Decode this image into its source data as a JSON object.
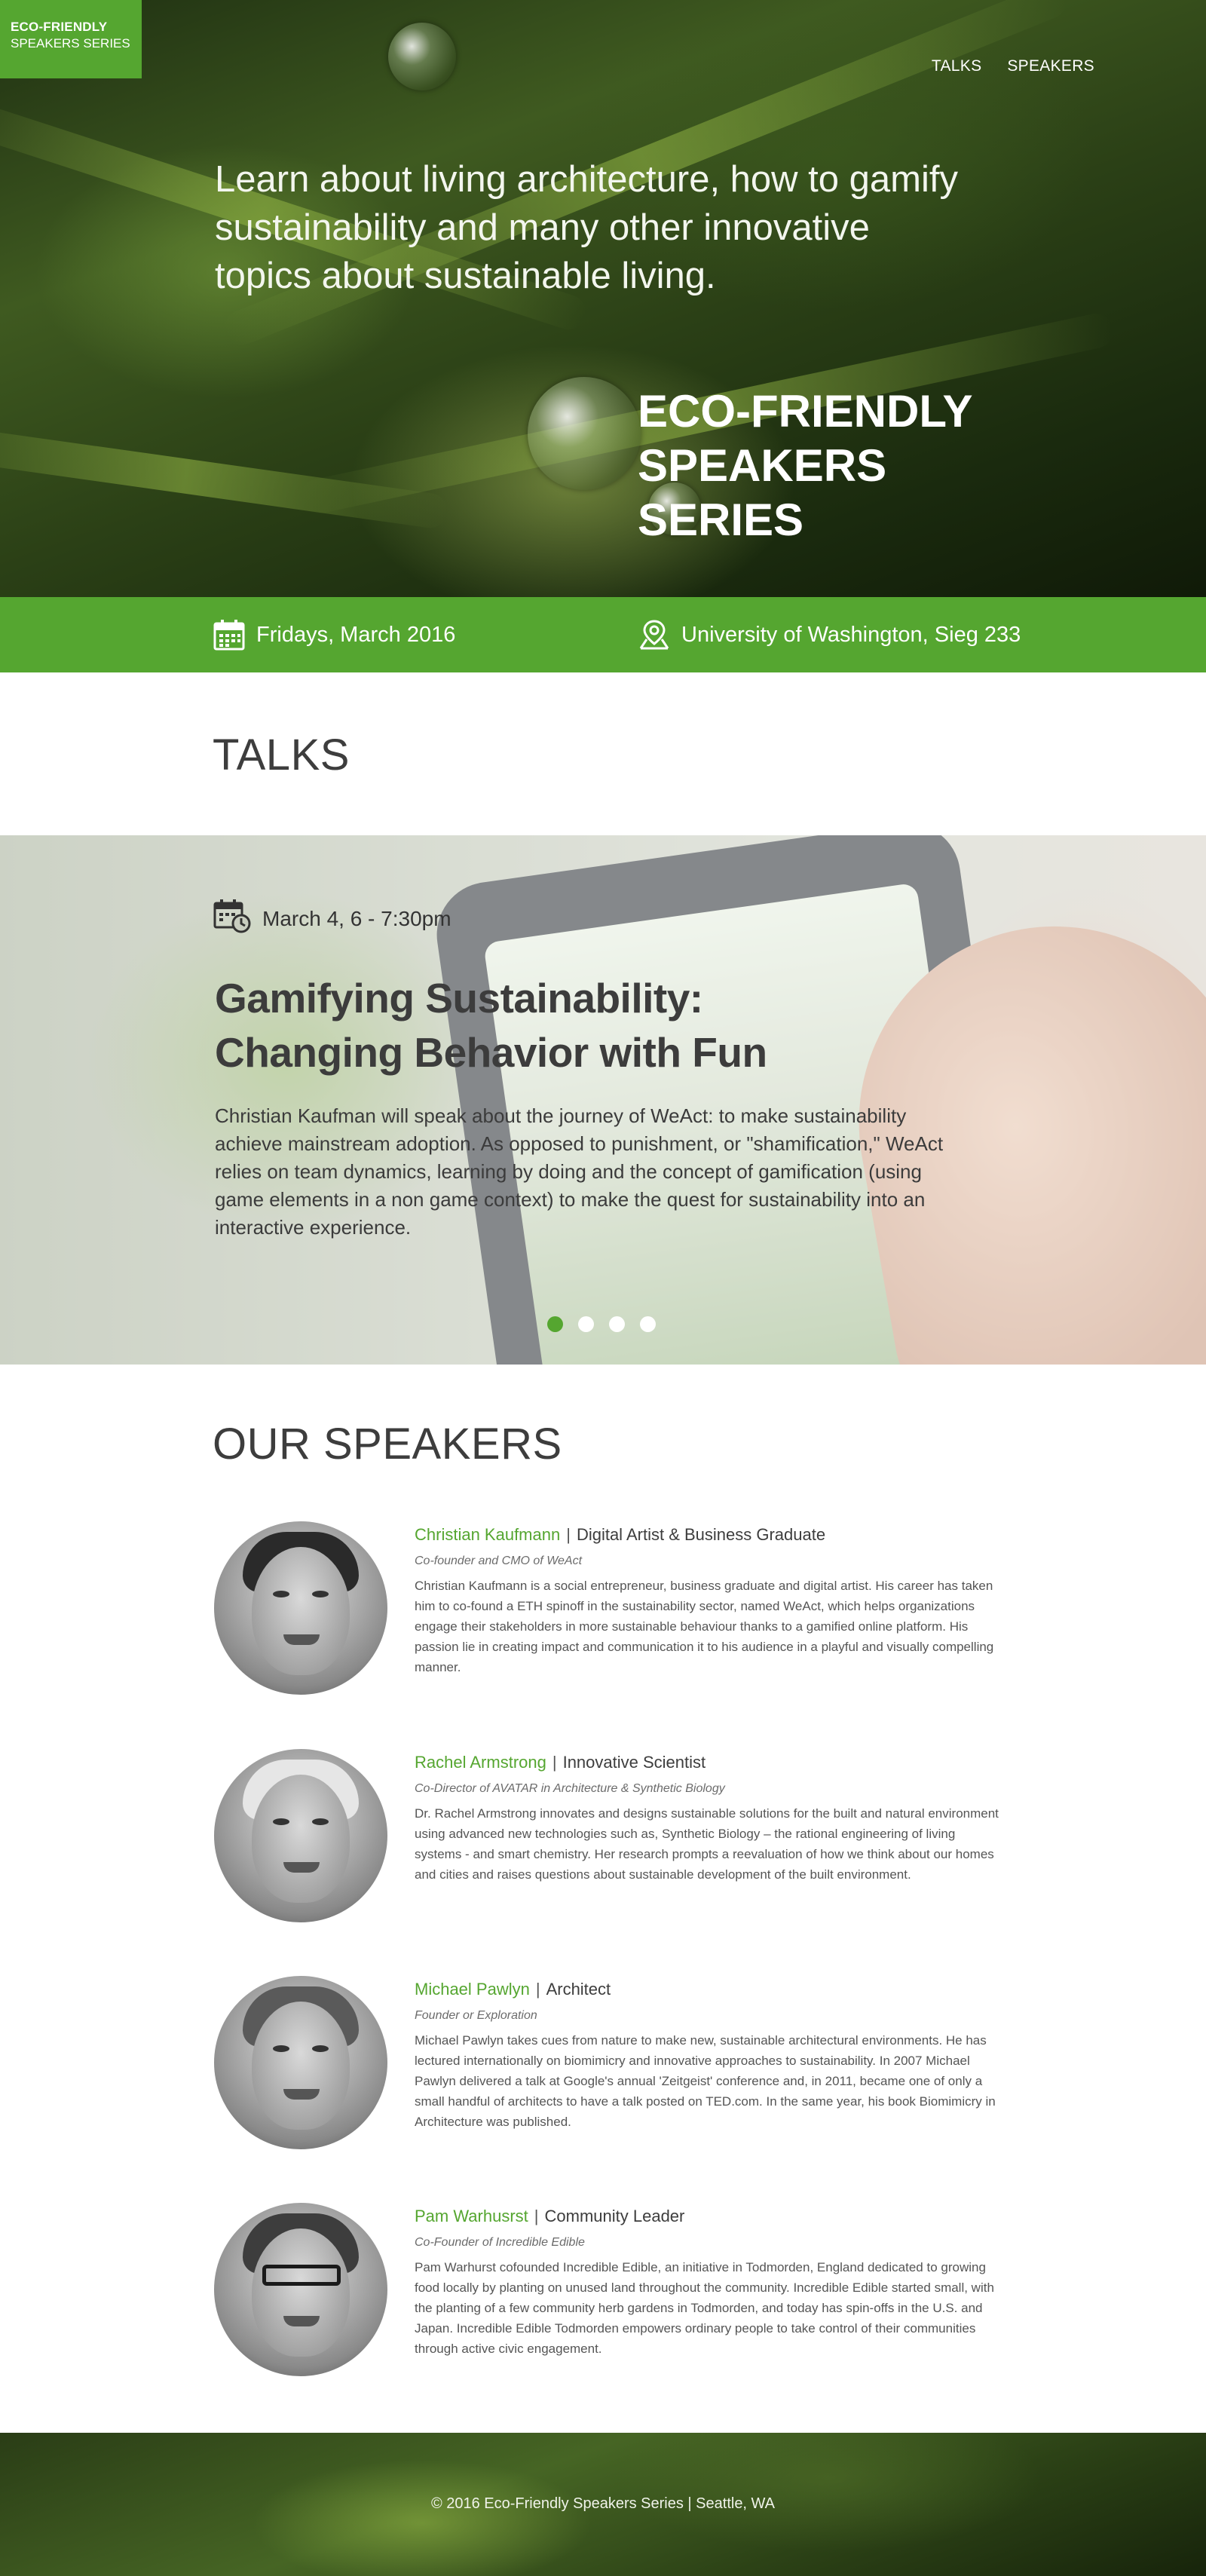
{
  "brand": {
    "line1": "ECO-FRIENDLY",
    "line2": "SPEAKERS SERIES",
    "accent_color": "#55a630"
  },
  "nav": {
    "items": [
      {
        "label": "TALKS"
      },
      {
        "label": "SPEAKERS"
      }
    ]
  },
  "hero": {
    "lead": "Learn about living architecture, how to gamify sustainability and many other innovative topics about sustainable living.",
    "title_line1": "ECO-FRIENDLY",
    "title_line2": "SPEAKERS SERIES"
  },
  "info_bar": {
    "date": {
      "icon": "calendar-icon",
      "text": "Fridays, March 2016"
    },
    "location": {
      "icon": "map-pin-icon",
      "text": "University of Washington, Sieg 233"
    }
  },
  "talks": {
    "section_title": "TALKS",
    "slide": {
      "date_icon": "calendar-clock-icon",
      "date": "March 4,  6 - 7:30pm",
      "title_line1": "Gamifying Sustainability:",
      "title_line2": "Changing Behavior with Fun",
      "description": "Christian  Kaufman will speak about the journey of WeAct: to make sustainability achieve mainstream adoption. As opposed to punishment, or \"shamification,\" WeAct relies on team dynamics, learning by doing and the concept of gamification (using game elements in a non game context) to make the quest for sustainability into an interactive experience."
    },
    "carousel": {
      "count": 4,
      "active_index": 0
    }
  },
  "speakers": {
    "section_title": "OUR SPEAKERS",
    "items": [
      {
        "name": "Christian Kaufmann",
        "role": "Digital Artist &  Business Graduate",
        "title": "Co-founder and CMO of WeAct",
        "bio": "Christian Kaufmann is a social entrepreneur, business graduate and digital artist. His career has taken him to co-found a ETH spinoff in the sustainability sector, named WeAct, which helps organizations engage their stakeholders in more sustainable behaviour thanks to a gamified online platform. His passion lie in creating impact and communication it to his audience in a playful and visually compelling manner."
      },
      {
        "name": "Rachel Armstrong",
        "role": "Innovative Scientist",
        "title": "Co-Director of AVATAR in Architecture & Synthetic Biology",
        "bio": "Dr. Rachel Armstrong innovates and designs sustainable solutions for the built and natural environment using advanced new technologies such as, Synthetic Biology – the rational engineering of living systems - and smart chemistry. Her research prompts a reevaluation of how we think about our homes and cities and raises questions about sustainable development of the built environment."
      },
      {
        "name": "Michael Pawlyn",
        "role": "Architect",
        "title": "Founder or Exploration",
        "bio": "Michael Pawlyn takes cues from nature to make new, sustainable architectural environments. He has lectured internationally on biomimicry and innovative approaches to sustainability. In 2007 Michael Pawlyn delivered a talk at Google's annual 'Zeitgeist' conference and, in 2011, became one of only a small handful of architects to have a talk posted on TED.com. In the same year, his book Biomimicry in Architecture was published."
      },
      {
        "name": "Pam Warhusrst",
        "role": "Community Leader",
        "title": "Co-Founder of Incredible Edible",
        "bio": "Pam Warhurst cofounded Incredible Edible, an initiative in Todmorden, England dedicated to growing food locally by planting on unused land throughout the community. Incredible Edible started small, with the planting of a few community herb gardens in Todmorden, and today has spin-offs in the U.S. and Japan. Incredible Edible Todmorden empowers ordinary people to take control of their communities through active civic engagement."
      }
    ]
  },
  "footer": {
    "text": "© 2016 Eco-Friendly Speakers Series | Seattle, WA"
  }
}
